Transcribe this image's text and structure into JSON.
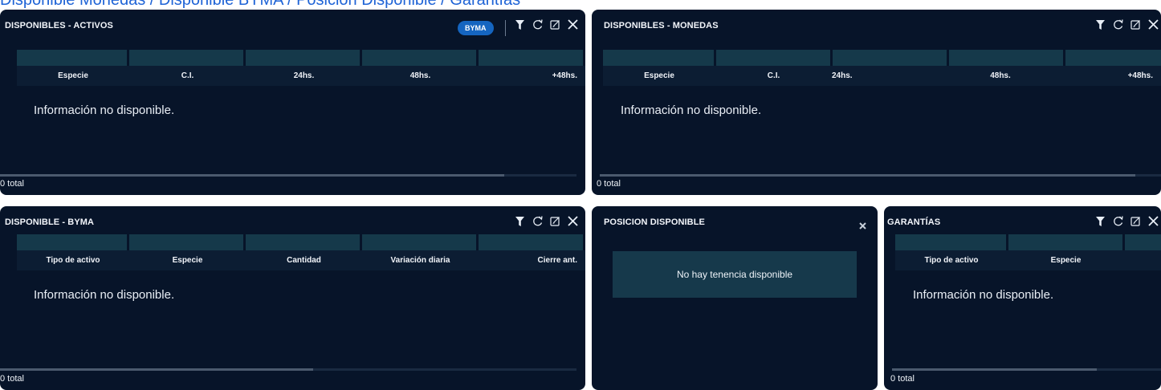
{
  "page_title": "Disponible Monedas / Disponible BYMA / Posición Disponible / Garantías",
  "panels": {
    "activos": {
      "title": "DISPONIBLES - ACTIVOS",
      "badge": "BYMA",
      "columns": [
        "Especie",
        "C.I.",
        "24hs.",
        "48hs.",
        "+48hs."
      ],
      "empty": "Información no disponible.",
      "total": "0 total"
    },
    "monedas": {
      "title": "DISPONIBLES - MONEDAS",
      "columns": [
        "Especie",
        "C.I.",
        "24hs.",
        "48hs.",
        "+48hs."
      ],
      "empty": "Información no disponible.",
      "total": "0 total"
    },
    "byma": {
      "title": "DISPONIBLE - BYMA",
      "columns": [
        "Tipo de activo",
        "Especie",
        "Cantidad",
        "Variación diaria",
        "Cierre ant."
      ],
      "empty": "Información no disponible.",
      "total": "0 total"
    },
    "posicion": {
      "title": "POSICION DISPONIBLE",
      "message": "No hay tenencia disponible"
    },
    "garantias": {
      "title": "GARANTÍAS",
      "columns": [
        "Tipo de activo",
        "Especie"
      ],
      "empty": "Información no disponible.",
      "total": "0 total"
    }
  },
  "icons": [
    "filter-icon",
    "refresh-icon",
    "edit-icon",
    "close-icon"
  ],
  "colors": {
    "panel_bg": "#071429",
    "filter_cell": "#15394a",
    "badge": "#1565c0",
    "title_link": "#1e63d6"
  }
}
